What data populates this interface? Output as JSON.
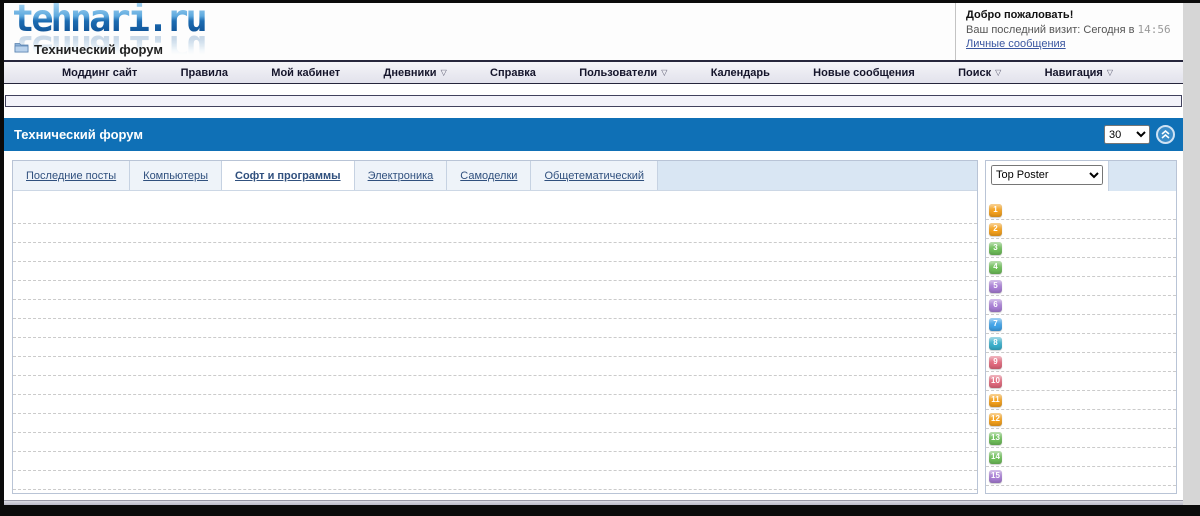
{
  "header": {
    "logo": "tehnari.ru",
    "subtitle": "Технический форум"
  },
  "welcome": {
    "title": "Добро пожаловать!",
    "visit_label": "Ваш последний визит: Сегодня в",
    "visit_time": "14:56",
    "messages_link": "Личные сообщения"
  },
  "nav": {
    "dropdown_glyph": "▽",
    "items": [
      {
        "label": "Моддинг сайт",
        "dropdown": false
      },
      {
        "label": "Правила",
        "dropdown": false
      },
      {
        "label": "Мой кабинет",
        "dropdown": false
      },
      {
        "label": "Дневники",
        "dropdown": true
      },
      {
        "label": "Справка",
        "dropdown": false
      },
      {
        "label": "Пользователи",
        "dropdown": true
      },
      {
        "label": "Календарь",
        "dropdown": false
      },
      {
        "label": "Новые сообщения",
        "dropdown": false
      },
      {
        "label": "Поиск",
        "dropdown": true
      },
      {
        "label": "Навигация",
        "dropdown": true
      }
    ]
  },
  "forum_header": {
    "title": "Технический форум",
    "page_size_value": "30"
  },
  "tabs": [
    {
      "label": "Последние посты",
      "active": false
    },
    {
      "label": "Компьютеры",
      "active": false
    },
    {
      "label": "Софт и программы",
      "active": true
    },
    {
      "label": "Электроника",
      "active": false
    },
    {
      "label": "Самоделки",
      "active": false
    },
    {
      "label": "Общетематический",
      "active": false
    }
  ],
  "main_panel": {
    "empty_row_count": 15
  },
  "sidebar": {
    "filter_value": "Top Poster",
    "badges": [
      {
        "number": "1",
        "color": "#f5a11c"
      },
      {
        "number": "2",
        "color": "#f5a11c"
      },
      {
        "number": "3",
        "color": "#6fbf5a"
      },
      {
        "number": "4",
        "color": "#6fbf5a"
      },
      {
        "number": "5",
        "color": "#a97fd6"
      },
      {
        "number": "6",
        "color": "#a97fd6"
      },
      {
        "number": "7",
        "color": "#41a3e8"
      },
      {
        "number": "8",
        "color": "#3bb0cc"
      },
      {
        "number": "9",
        "color": "#e2697d"
      },
      {
        "number": "10",
        "color": "#e2697d"
      },
      {
        "number": "11",
        "color": "#f5a11c"
      },
      {
        "number": "12",
        "color": "#f5a11c"
      },
      {
        "number": "13",
        "color": "#6fbf5a"
      },
      {
        "number": "14",
        "color": "#6fbf5a"
      },
      {
        "number": "15",
        "color": "#a97fd6"
      }
    ]
  },
  "colors": {
    "accent_blue": "#0f70b6",
    "tab_fill": "#d9e6f3",
    "link": "#3a56a0"
  }
}
